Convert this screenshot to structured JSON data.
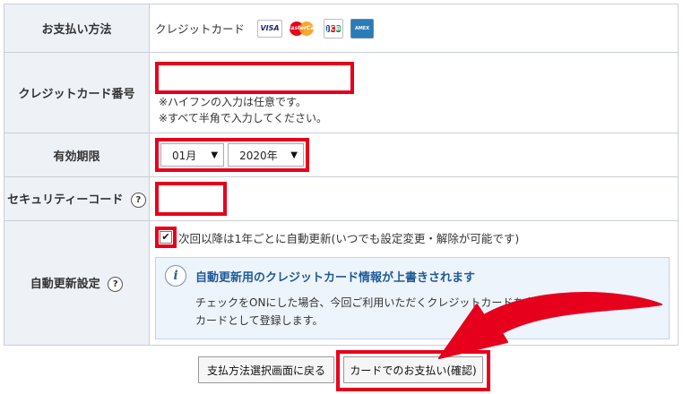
{
  "rows": {
    "payment": {
      "label": "お支払い方法",
      "value": "クレジットカード",
      "logos": {
        "visa": "VISA",
        "master": "MasterCard",
        "jcb": "JCB",
        "amex": "AMEX"
      }
    },
    "card_number": {
      "label": "クレジットカード番号",
      "value": "",
      "notes": [
        "※ハイフンの入力は任意です。",
        "※すべて半角で入力してください。"
      ]
    },
    "expiry": {
      "label": "有効期限",
      "month": "01月",
      "year": "2020年"
    },
    "security": {
      "label": "セキュリティーコード",
      "help": "?",
      "value": ""
    },
    "auto_renew": {
      "label": "自動更新設定",
      "help": "?",
      "checkbox_label": "次回以降は1年ごとに自動更新(いつでも設定変更・解除が可能です)",
      "checked": true,
      "info_icon": "i",
      "info_title": "自動更新用のクレジットカード情報が上書きされます",
      "info_body_1": "チェックをONにした場合、今回ご利用いただくクレジットカードを自動更新用のクレジット",
      "info_body_2": "カードとして登録します。"
    }
  },
  "buttons": {
    "back": "支払方法選択画面に戻る",
    "confirm": "カードでのお支払い(確認)"
  },
  "colors": {
    "highlight": "#e6001c",
    "label_bg": "#eef2f7",
    "info_title": "#1f5a96",
    "info_bg": "#eef4fc"
  },
  "icons": {
    "checkmark": "check-icon",
    "arrow": "red-arrow-icon",
    "help": "help-icon",
    "info": "info-icon"
  }
}
